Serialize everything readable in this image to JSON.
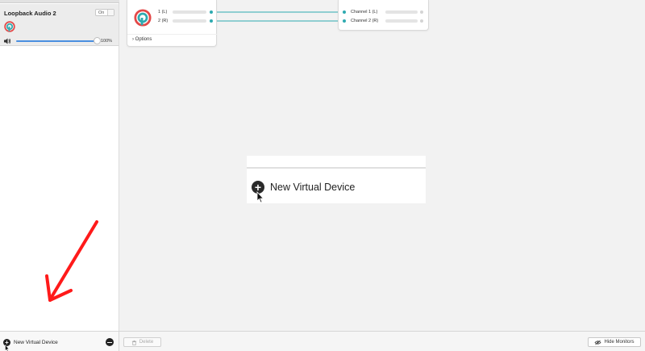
{
  "sidebar": {
    "device": {
      "name": "Loopback Audio 2",
      "toggle_label": "On",
      "volume_value": "100%",
      "volume_level": 1.0
    },
    "bottom": {
      "new_device_label": "New Virtual Device"
    }
  },
  "canvas": {
    "source_box": {
      "channels": [
        "1 (L)",
        "2 (R)"
      ],
      "options_label": "Options"
    },
    "output_box": {
      "channels": [
        "Channel 1 (L)",
        "Channel 2 (R)"
      ]
    },
    "popup": {
      "item_label": "New Virtual Device"
    }
  },
  "toolbar": {
    "delete_label": "Delete",
    "hide_monitors_label": "Hide Monitors"
  },
  "colors": {
    "wire": "#2eaab0",
    "arrow": "#ff1a1a",
    "slider": "#4a8fe0"
  }
}
